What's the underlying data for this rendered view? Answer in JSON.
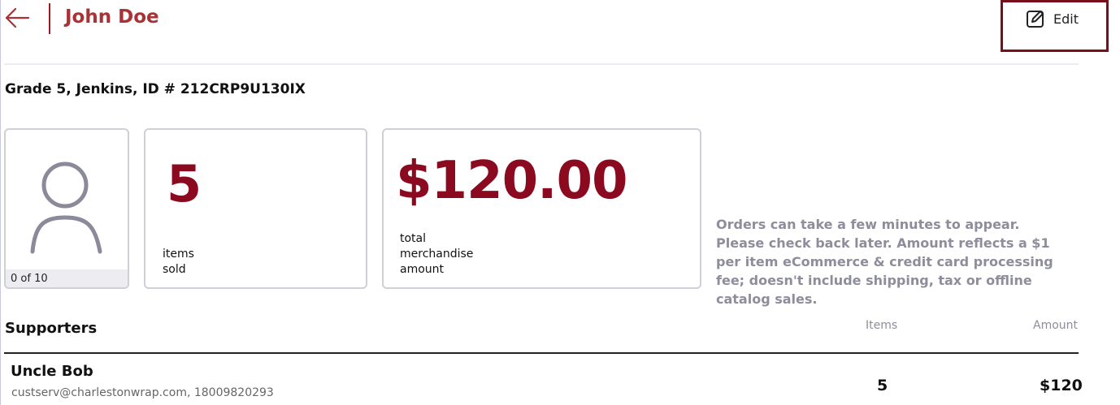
{
  "header": {
    "title": "John Doe",
    "edit_label": "Edit",
    "accent_color": "#8b0a1f"
  },
  "student": {
    "info": "Grade 5, Jenkins, ID # 212CRP9U130IX"
  },
  "stats": {
    "progress_text": "0 of 10",
    "items_sold_value": "5",
    "items_sold_label": "items sold",
    "total_amount_value": "$120.00",
    "total_amount_label": "total merchandise amount"
  },
  "notice": "Orders can take a few minutes to appear. Please check back later. Amount reflects a $1 per item eCommerce & credit card processing fee; doesn't include shipping, tax or offline catalog sales.",
  "supporters": {
    "heading": "Supporters",
    "col_items": "Items",
    "col_amount": "Amount",
    "rows": [
      {
        "name": "Uncle Bob",
        "contact": "custserv@charlestonwrap.com, 18009820293",
        "items": "5",
        "amount": "$120"
      }
    ]
  },
  "icons": {
    "back": "arrow-left-icon",
    "edit": "edit-icon",
    "avatar": "user-icon"
  }
}
